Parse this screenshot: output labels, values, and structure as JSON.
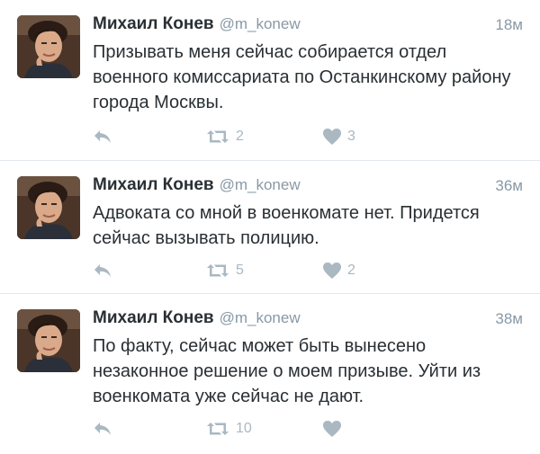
{
  "tweets": [
    {
      "author": "Михаил Конев",
      "handle": "@m_konew",
      "time": "18м",
      "text": "Призывать меня сейчас собирается отдел военного комиссариата по Останкинскому району города Москвы.",
      "retweets": "2",
      "likes": "3"
    },
    {
      "author": "Михаил Конев",
      "handle": "@m_konew",
      "time": "36м",
      "text": "Адвоката со мной в военкомате нет. Придется сейчас вызывать полицию.",
      "retweets": "5",
      "likes": "2"
    },
    {
      "author": "Михаил Конев",
      "handle": "@m_konew",
      "time": "38м",
      "text": "По факту, сейчас может быть вынесено незаконное решение о моем призыве. Уйти из военкомата уже сейчас не дают.",
      "retweets": "10",
      "likes": ""
    }
  ],
  "icons": {
    "reply": "reply-icon",
    "retweet": "retweet-icon",
    "like": "heart-icon"
  },
  "colors": {
    "text": "#292f33",
    "muted": "#8899a6",
    "action": "#aab8c2",
    "divider": "#e1e8ed"
  }
}
